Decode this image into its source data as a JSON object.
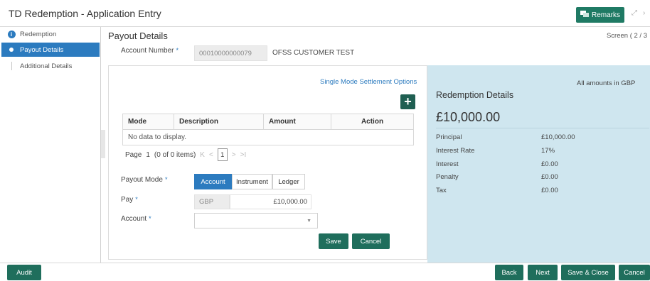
{
  "window": {
    "title": "TD Redemption - Application Entry",
    "remarks_label": "Remarks"
  },
  "sidebar": {
    "items": [
      {
        "label": "Redemption"
      },
      {
        "label": "Payout Details"
      },
      {
        "label": "Additional Details"
      }
    ]
  },
  "header": {
    "title": "Payout Details",
    "screen": "Screen ( 2 / 3"
  },
  "account": {
    "label": "Account Number",
    "required_mark": "*",
    "number": "00010000000079",
    "name": "OFSS CUSTOMER TEST"
  },
  "settlement": {
    "link": "Single Mode Settlement Options",
    "add_icon": "+",
    "columns": [
      "Mode",
      "Description",
      "Amount",
      "Action"
    ],
    "empty_text": "No data to display.",
    "pager": {
      "page_label": "Page",
      "page_num": "1",
      "items_text": "(0 of 0 items)",
      "first": "K",
      "prev": "<",
      "current": "1",
      "next": ">",
      "last": ">I"
    }
  },
  "payout": {
    "mode_label": "Payout Mode",
    "modes": [
      "Account",
      "Instrument",
      "Ledger"
    ],
    "selected_mode": "Account",
    "pay_label": "Pay",
    "pay_currency": "GBP",
    "pay_amount": "£10,000.00",
    "account_label": "Account",
    "account_value": "",
    "required_mark": "*",
    "save_label": "Save",
    "cancel_label": "Cancel"
  },
  "details": {
    "note": "All amounts in GBP",
    "title": "Redemption Details",
    "total": "£10,000.00",
    "rows": [
      {
        "label": "Principal",
        "value": "£10,000.00"
      },
      {
        "label": "Interest Rate",
        "value": "17%"
      },
      {
        "label": "Interest",
        "value": "£0.00"
      },
      {
        "label": "Penalty",
        "value": "£0.00"
      },
      {
        "label": "Tax",
        "value": "£0.00"
      }
    ]
  },
  "footer": {
    "audit": "Audit",
    "back": "Back",
    "next": "Next",
    "save_close": "Save & Close",
    "cancel": "Cancel"
  },
  "colors": {
    "accent": "#2c7bbf",
    "button": "#1f6e5c",
    "details_bg": "#cfe6ef"
  }
}
